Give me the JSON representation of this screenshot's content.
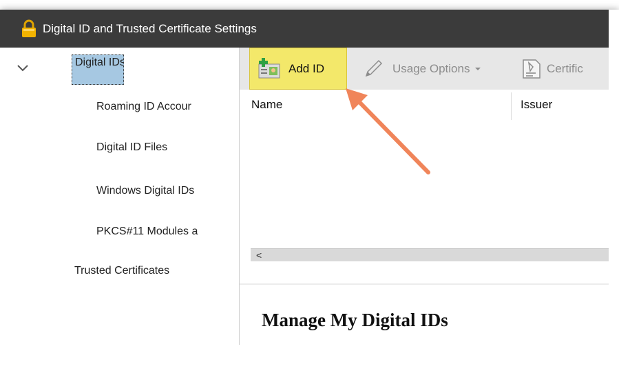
{
  "window": {
    "title": "Digital ID and Trusted Certificate Settings"
  },
  "tree": {
    "items": [
      {
        "label": "Digital IDs"
      },
      {
        "label": "Roaming ID Accour"
      },
      {
        "label": "Digital ID Files"
      },
      {
        "label": "Windows Digital IDs"
      },
      {
        "label": "PKCS#11 Modules a"
      },
      {
        "label": "Trusted Certificates"
      }
    ]
  },
  "toolbar": {
    "add_id": "Add ID",
    "usage_options": "Usage Options",
    "certificate": "Certific"
  },
  "table": {
    "columns": [
      "Name",
      "Issuer"
    ],
    "scroll_left": "<"
  },
  "details": {
    "title": "Manage My Digital IDs"
  },
  "colors": {
    "titlebar": "#3b3b3b",
    "selected_item": "#a6c8e2",
    "add_id_highlight": "#f3e86a",
    "annotation_arrow": "#f0855a"
  }
}
